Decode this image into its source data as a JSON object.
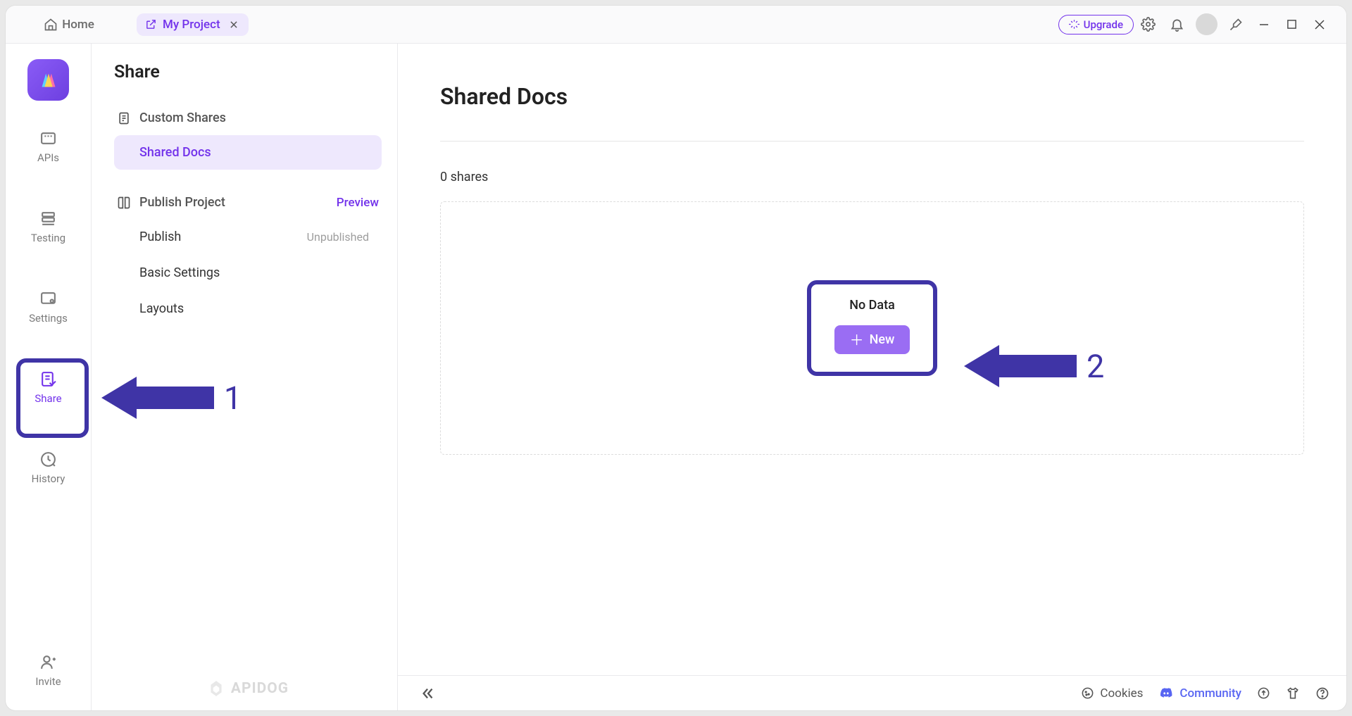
{
  "titlebar": {
    "home_label": "Home",
    "tab_label": "My Project",
    "upgrade_label": "Upgrade"
  },
  "rail": {
    "items": [
      "APIs",
      "Testing",
      "Settings",
      "Share",
      "History"
    ],
    "invite_label": "Invite"
  },
  "panel": {
    "title": "Share",
    "custom_shares": "Custom Shares",
    "shared_docs": "Shared Docs",
    "publish_project": "Publish Project",
    "preview": "Preview",
    "publish": "Publish",
    "unpublished": "Unpublished",
    "basic_settings": "Basic Settings",
    "layouts": "Layouts",
    "brand": "APIDOG"
  },
  "main": {
    "title": "Shared Docs",
    "count_label": "0 shares",
    "no_data": "No Data",
    "new_label": "New"
  },
  "footer": {
    "cookies": "Cookies",
    "community": "Community"
  },
  "annotations": {
    "a1": "1",
    "a2": "2"
  }
}
